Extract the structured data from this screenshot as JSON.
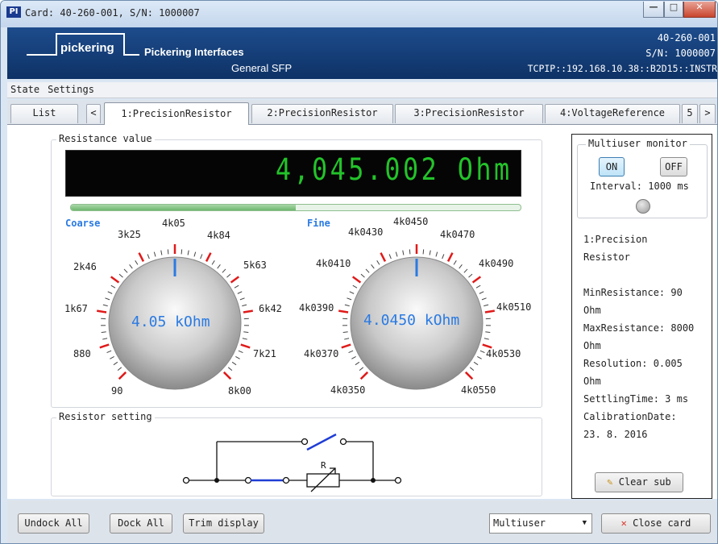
{
  "window": {
    "title": "Card: 40-260-001,  S/N: 1000007",
    "icon_text": "PI"
  },
  "header": {
    "brand": "pickering",
    "company": "Pickering Interfaces",
    "product": "General SFP",
    "card": "40-260-001",
    "serial": "S/N: 1000007",
    "address": "TCPIP::192.168.10.38::B2D15::INSTR"
  },
  "menu": {
    "state": "State",
    "settings": "Settings"
  },
  "tabs": {
    "list": "List",
    "prev": "<",
    "t1": "1:PrecisionResistor",
    "t2": "2:PrecisionResistor",
    "t3": "3:PrecisionResistor",
    "t4": "4:VoltageReference",
    "t5": "5",
    "next": ">"
  },
  "resistance": {
    "group_title": "Resistance value",
    "display": "4,045.002 Ohm",
    "level": 0.5
  },
  "coarse": {
    "label": "Coarse",
    "value": "4.05 kOhm",
    "ticks": [
      "90",
      "880",
      "1k67",
      "2k46",
      "3k25",
      "4k05",
      "4k84",
      "5k63",
      "6k42",
      "7k21",
      "8k00"
    ]
  },
  "fine": {
    "label": "Fine",
    "value": "4.0450 kOhm",
    "ticks": [
      "4k0350",
      "4k0370",
      "4k0390",
      "4k0410",
      "4k0430",
      "4k0450",
      "4k0470",
      "4k0490",
      "4k0510",
      "4k0530",
      "4k0550"
    ]
  },
  "setting": {
    "group_title": "Resistor setting",
    "r_label": "R"
  },
  "monitor": {
    "title": "Multiuser monitor",
    "on": "ON",
    "off": "OFF",
    "interval": "Interval: 1000 ms"
  },
  "info": {
    "name1": "1:Precision",
    "name2": "Resistor",
    "min1": "MinResistance: 90",
    "min2": "Ohm",
    "max1": "MaxResistance: 8000",
    "max2": "Ohm",
    "res1": "Resolution: 0.005",
    "res2": "Ohm",
    "settle": "SettlingTime: 3 ms",
    "cal1": "CalibrationDate:",
    "cal2": "23. 8. 2016"
  },
  "buttons": {
    "clear_sub": "Clear sub",
    "undock": "Undock All",
    "dock": "Dock All",
    "trim": "Trim display",
    "mode": "Multiuser",
    "close": "Close card"
  },
  "colors": {
    "accent": "#2a7ae2",
    "lcd": "#23c32a",
    "header": "#123c78",
    "close_x": "#d9342b"
  }
}
